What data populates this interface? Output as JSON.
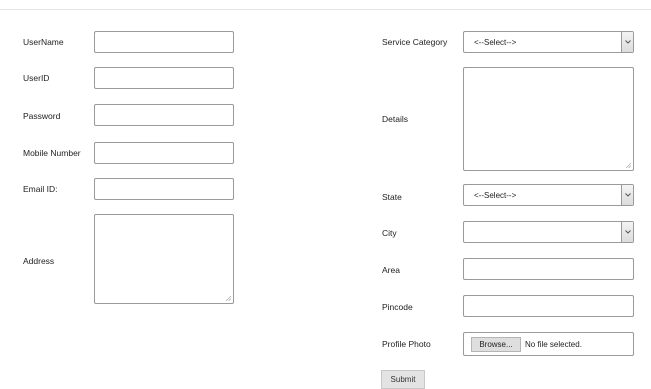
{
  "left_form": {
    "username_label": "UserName",
    "username_value": "",
    "userid_label": "UserID",
    "userid_value": "",
    "password_label": "Password",
    "password_value": "",
    "mobile_label": "Mobile Number",
    "mobile_value": "",
    "email_label": "Email ID:",
    "email_value": "",
    "address_label": "Address",
    "address_value": ""
  },
  "right_form": {
    "service_category_label": "Service Category",
    "service_category_selected": "<--Select-->",
    "details_label": "Details",
    "details_value": "",
    "state_label": "State",
    "state_selected": "<--Select-->",
    "city_label": "City",
    "city_selected": "",
    "area_label": "Area",
    "area_value": "",
    "pincode_label": "Pincode",
    "pincode_value": "",
    "profile_photo_label": "Profile Photo",
    "browse_label": "Browse...",
    "file_status": "No file selected.",
    "submit_label": "Submit"
  },
  "icons": {
    "select_arrow": "chevron-down-icon",
    "textarea_grip": "resize-grip-icon"
  }
}
